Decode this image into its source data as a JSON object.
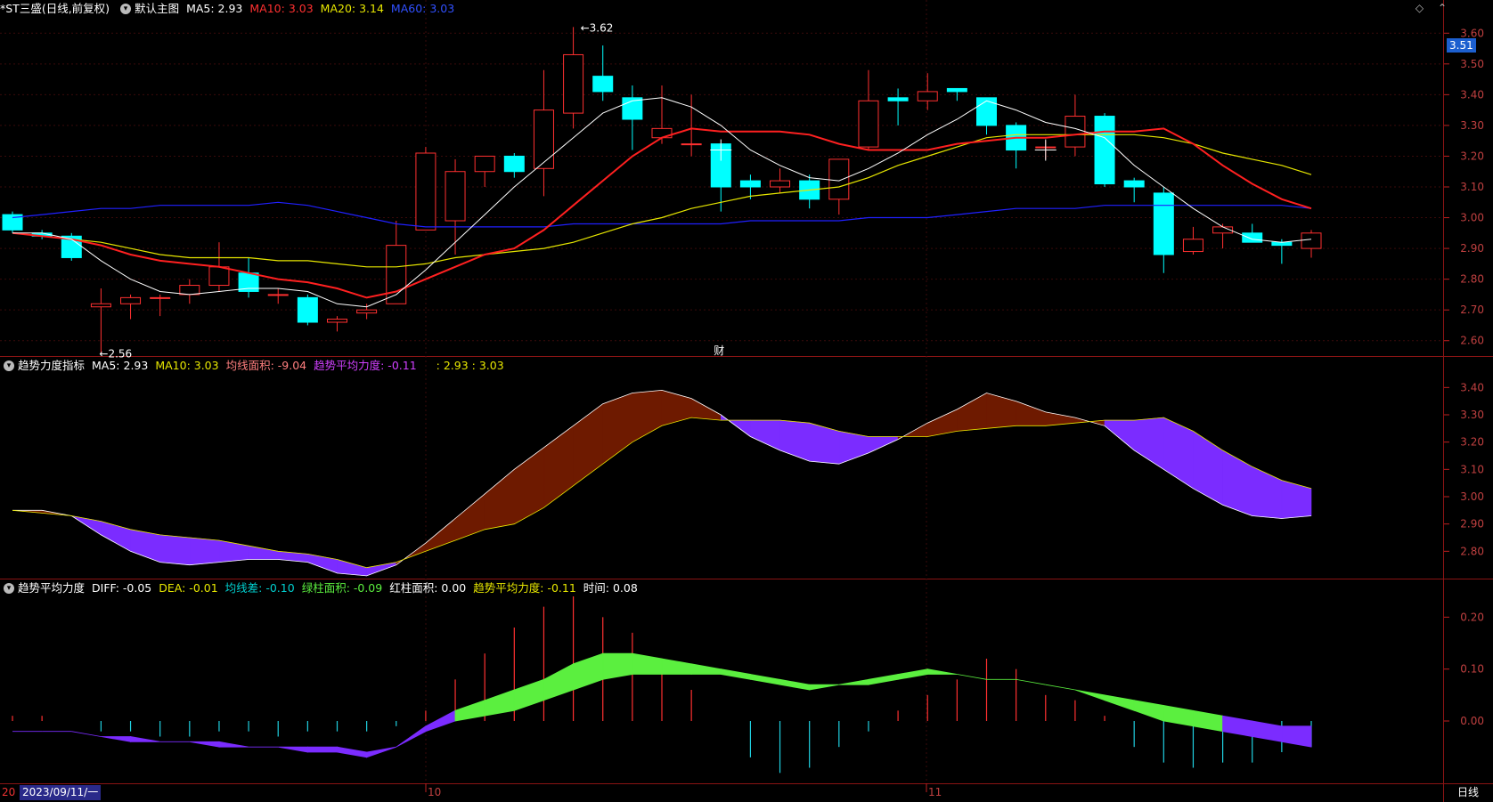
{
  "main": {
    "title": "*ST三盛(日线,前复权)",
    "chart_name": "默认主图",
    "ma5": "MA5: 2.93",
    "ma10": "MA10: 3.03",
    "ma20": "MA20: 3.14",
    "ma60": "MA60: 3.03",
    "current_price_tag": "3.51",
    "high_label": "3.62",
    "low_label": "2.56",
    "event_marker": "财",
    "y_ticks": [
      "3.60",
      "3.50",
      "3.40",
      "3.30",
      "3.20",
      "3.10",
      "3.00",
      "2.90",
      "2.80",
      "2.70",
      "2.60"
    ]
  },
  "ind1": {
    "name": "趋势力度指标",
    "ma5": "MA5: 2.93",
    "ma10": "MA10: 3.03",
    "area": "均线面积: -9.04",
    "avg_force": "趋势平均力度: -0.11",
    "extra": ": 2.93 : 3.03",
    "y_ticks": [
      "3.40",
      "3.30",
      "3.20",
      "3.10",
      "3.00",
      "2.90",
      "2.80"
    ]
  },
  "ind2": {
    "name": "趋势平均力度",
    "diff": "DIFF: -0.05",
    "dea": "DEA: -0.01",
    "junxian": "均线差: -0.10",
    "green_area": "绿柱面积: -0.09",
    "red_area": "红柱面积: 0.00",
    "avg_force": "趋势平均力度: -0.11",
    "time": "时间: 0.08",
    "y_ticks": [
      "0.20",
      "0.10",
      "0.00"
    ]
  },
  "xaxis": {
    "date_prefix": "20",
    "date": "2023/09/11/一",
    "month_10": "10",
    "month_11": "11",
    "period": "日线"
  },
  "colors": {
    "up": "#ff3030",
    "down": "#00ffff",
    "ma5": "#ffffff",
    "ma10": "#ff2020",
    "ma20": "#e6e600",
    "ma60": "#2020ff",
    "purple": "#7b2cff",
    "brown": "#6e1a00",
    "green": "#5bef3f"
  },
  "chart_data": [
    {
      "type": "candlestick",
      "title": "*ST三盛(日线,前复权)",
      "ylim": [
        2.55,
        3.65
      ],
      "candles": [
        [
          3.01,
          2.96,
          3.02,
          2.95
        ],
        [
          2.95,
          2.94,
          2.96,
          2.93
        ],
        [
          2.94,
          2.87,
          2.95,
          2.86
        ],
        [
          2.71,
          2.72,
          2.77,
          2.56
        ],
        [
          2.72,
          2.74,
          2.75,
          2.67
        ],
        [
          2.74,
          2.74,
          2.75,
          2.68
        ],
        [
          2.75,
          2.78,
          2.8,
          2.72
        ],
        [
          2.78,
          2.84,
          2.92,
          2.76
        ],
        [
          2.82,
          2.76,
          2.87,
          2.74
        ],
        [
          2.75,
          2.75,
          2.77,
          2.72
        ],
        [
          2.74,
          2.66,
          2.75,
          2.65
        ],
        [
          2.66,
          2.67,
          2.68,
          2.63
        ],
        [
          2.69,
          2.7,
          2.72,
          2.67
        ],
        [
          2.72,
          2.91,
          2.99,
          2.72
        ],
        [
          2.96,
          3.21,
          3.23,
          2.97
        ],
        [
          2.99,
          3.15,
          3.19,
          2.88
        ],
        [
          3.15,
          3.2,
          3.2,
          3.1
        ],
        [
          3.2,
          3.15,
          3.21,
          3.13
        ],
        [
          3.16,
          3.35,
          3.48,
          3.07
        ],
        [
          3.34,
          3.53,
          3.62,
          3.29
        ],
        [
          3.46,
          3.41,
          3.56,
          3.38
        ],
        [
          3.39,
          3.32,
          3.43,
          3.22
        ],
        [
          3.26,
          3.29,
          3.43,
          3.24
        ],
        [
          3.24,
          3.24,
          3.4,
          3.2
        ],
        [
          3.24,
          3.1,
          3.24,
          3.02
        ],
        [
          3.12,
          3.1,
          3.14,
          3.06
        ],
        [
          3.1,
          3.12,
          3.16,
          3.08
        ],
        [
          3.12,
          3.06,
          3.14,
          3.03
        ],
        [
          3.06,
          3.19,
          3.19,
          3.01
        ],
        [
          3.23,
          3.38,
          3.48,
          3.22
        ],
        [
          3.39,
          3.38,
          3.42,
          3.3
        ],
        [
          3.38,
          3.41,
          3.47,
          3.35
        ],
        [
          3.42,
          3.41,
          3.42,
          3.38
        ],
        [
          3.39,
          3.3,
          3.39,
          3.27
        ],
        [
          3.3,
          3.22,
          3.31,
          3.16
        ],
        [
          3.23,
          3.23,
          3.25,
          3.19
        ],
        [
          3.23,
          3.33,
          3.4,
          3.2
        ],
        [
          3.33,
          3.11,
          3.34,
          3.1
        ],
        [
          3.12,
          3.1,
          3.13,
          3.05
        ],
        [
          3.08,
          2.88,
          3.1,
          2.82
        ],
        [
          2.89,
          2.93,
          2.97,
          2.88
        ],
        [
          2.95,
          2.97,
          2.98,
          2.9
        ],
        [
          2.95,
          2.92,
          2.98,
          2.92
        ],
        [
          2.92,
          2.91,
          2.93,
          2.85
        ],
        [
          2.9,
          2.95,
          2.96,
          2.87
        ]
      ],
      "ma5": [
        2.95,
        2.95,
        2.93,
        2.86,
        2.8,
        2.76,
        2.75,
        2.76,
        2.77,
        2.77,
        2.76,
        2.72,
        2.71,
        2.75,
        2.83,
        2.92,
        3.01,
        3.1,
        3.18,
        3.26,
        3.34,
        3.38,
        3.39,
        3.36,
        3.3,
        3.22,
        3.17,
        3.13,
        3.12,
        3.16,
        3.21,
        3.27,
        3.32,
        3.38,
        3.35,
        3.31,
        3.29,
        3.26,
        3.17,
        3.1,
        3.03,
        2.97,
        2.93,
        2.92,
        2.93
      ],
      "ma10": [
        2.95,
        2.94,
        2.93,
        2.91,
        2.88,
        2.86,
        2.85,
        2.84,
        2.82,
        2.8,
        2.79,
        2.77,
        2.74,
        2.76,
        2.8,
        2.84,
        2.88,
        2.9,
        2.96,
        3.04,
        3.12,
        3.2,
        3.26,
        3.29,
        3.28,
        3.28,
        3.28,
        3.27,
        3.24,
        3.22,
        3.22,
        3.22,
        3.24,
        3.25,
        3.26,
        3.26,
        3.27,
        3.28,
        3.28,
        3.29,
        3.24,
        3.17,
        3.11,
        3.06,
        3.03
      ],
      "ma20": [
        2.95,
        2.94,
        2.93,
        2.92,
        2.9,
        2.88,
        2.87,
        2.87,
        2.87,
        2.86,
        2.86,
        2.85,
        2.84,
        2.84,
        2.85,
        2.87,
        2.88,
        2.89,
        2.9,
        2.92,
        2.95,
        2.98,
        3.0,
        3.03,
        3.05,
        3.07,
        3.08,
        3.09,
        3.1,
        3.13,
        3.17,
        3.2,
        3.23,
        3.26,
        3.27,
        3.27,
        3.27,
        3.27,
        3.27,
        3.26,
        3.24,
        3.21,
        3.19,
        3.17,
        3.14
      ],
      "ma60": [
        3.0,
        3.01,
        3.02,
        3.03,
        3.03,
        3.04,
        3.04,
        3.04,
        3.04,
        3.05,
        3.04,
        3.02,
        3.0,
        2.98,
        2.97,
        2.97,
        2.97,
        2.97,
        2.97,
        2.98,
        2.98,
        2.98,
        2.98,
        2.98,
        2.98,
        2.99,
        2.99,
        2.99,
        2.99,
        3.0,
        3.0,
        3.0,
        3.01,
        3.02,
        3.03,
        3.03,
        3.03,
        3.04,
        3.04,
        3.04,
        3.04,
        3.04,
        3.04,
        3.04,
        3.03
      ]
    },
    {
      "type": "area",
      "title": "趋势力度指标",
      "ylim": [
        2.7,
        3.45
      ],
      "upper": [
        2.95,
        2.95,
        2.93,
        2.86,
        2.8,
        2.76,
        2.75,
        2.76,
        2.77,
        2.77,
        2.76,
        2.72,
        2.71,
        2.75,
        2.83,
        2.92,
        3.01,
        3.1,
        3.18,
        3.26,
        3.34,
        3.38,
        3.39,
        3.36,
        3.3,
        3.22,
        3.17,
        3.13,
        3.12,
        3.16,
        3.21,
        3.27,
        3.32,
        3.38,
        3.35,
        3.31,
        3.29,
        3.26,
        3.17,
        3.1,
        3.03,
        2.97,
        2.93,
        2.92,
        2.93
      ],
      "lower": [
        2.95,
        2.94,
        2.93,
        2.91,
        2.88,
        2.86,
        2.85,
        2.84,
        2.82,
        2.8,
        2.79,
        2.77,
        2.74,
        2.76,
        2.8,
        2.84,
        2.88,
        2.9,
        2.96,
        3.04,
        3.12,
        3.2,
        3.26,
        3.29,
        3.28,
        3.28,
        3.28,
        3.27,
        3.24,
        3.22,
        3.22,
        3.22,
        3.24,
        3.25,
        3.26,
        3.26,
        3.27,
        3.28,
        3.28,
        3.29,
        3.24,
        3.17,
        3.11,
        3.06,
        3.03
      ]
    },
    {
      "type": "bar",
      "title": "趋势平均力度",
      "ylim": [
        -0.12,
        0.24
      ],
      "bars": [
        0.01,
        0.01,
        0,
        -0.02,
        -0.02,
        -0.03,
        -0.03,
        -0.02,
        -0.02,
        -0.03,
        -0.02,
        -0.02,
        -0.02,
        -0.01,
        0.02,
        0.08,
        0.13,
        0.18,
        0.22,
        0.24,
        0.2,
        0.17,
        0.12,
        0.06,
        0,
        -0.07,
        -0.1,
        -0.09,
        -0.05,
        -0.02,
        0.02,
        0.05,
        0.08,
        0.12,
        0.1,
        0.05,
        0.04,
        0.01,
        -0.05,
        -0.08,
        -0.09,
        -0.08,
        -0.08,
        -0.06,
        -0.05
      ],
      "band_upper": [
        -0.02,
        -0.02,
        -0.02,
        -0.03,
        -0.04,
        -0.04,
        -0.04,
        -0.04,
        -0.05,
        -0.05,
        -0.05,
        -0.05,
        -0.06,
        -0.05,
        -0.01,
        0.02,
        0.04,
        0.06,
        0.08,
        0.11,
        0.13,
        0.13,
        0.12,
        0.11,
        0.1,
        0.09,
        0.08,
        0.07,
        0.07,
        0.08,
        0.09,
        0.1,
        0.09,
        0.08,
        0.08,
        0.07,
        0.06,
        0.04,
        0.02,
        0.0,
        -0.01,
        -0.02,
        -0.03,
        -0.04,
        -0.05
      ],
      "band_lower": [
        -0.02,
        -0.02,
        -0.02,
        -0.03,
        -0.03,
        -0.04,
        -0.04,
        -0.05,
        -0.05,
        -0.05,
        -0.06,
        -0.06,
        -0.07,
        -0.05,
        -0.02,
        0.0,
        0.01,
        0.02,
        0.04,
        0.06,
        0.08,
        0.09,
        0.09,
        0.09,
        0.09,
        0.08,
        0.07,
        0.06,
        0.07,
        0.07,
        0.08,
        0.09,
        0.09,
        0.08,
        0.08,
        0.07,
        0.06,
        0.05,
        0.04,
        0.03,
        0.02,
        0.01,
        0.0,
        -0.01,
        -0.01
      ]
    }
  ]
}
